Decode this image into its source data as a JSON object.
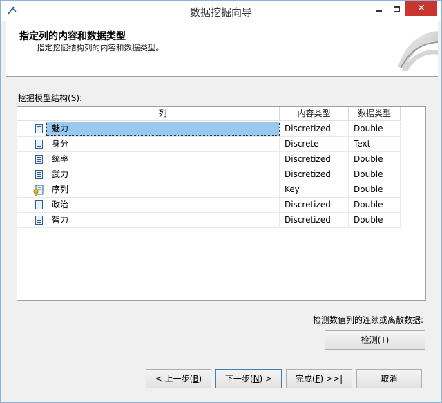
{
  "window": {
    "title": "数据挖掘向导",
    "close_glyph": "✕"
  },
  "header": {
    "title": "指定列的内容和数据类型",
    "subtitle": "指定挖掘结构列的内容和数据类型。"
  },
  "structure": {
    "label_pre": "挖掘模型结构(",
    "label_key": "S",
    "label_post": "):",
    "columns": {
      "name": "列",
      "content_type": "内容类型",
      "data_type": "数据类型"
    },
    "rows": [
      {
        "name": "魅力",
        "content_type": "Discretized",
        "data_type": "Double",
        "icon": "column-icon"
      },
      {
        "name": "身分",
        "content_type": "Discrete",
        "data_type": "Text",
        "icon": "column-icon"
      },
      {
        "name": "统率",
        "content_type": "Discretized",
        "data_type": "Double",
        "icon": "column-icon"
      },
      {
        "name": "武力",
        "content_type": "Discretized",
        "data_type": "Double",
        "icon": "column-icon"
      },
      {
        "name": "序列",
        "content_type": "Key",
        "data_type": "Double",
        "icon": "key-column-icon"
      },
      {
        "name": "政治",
        "content_type": "Discretized",
        "data_type": "Double",
        "icon": "column-icon"
      },
      {
        "name": "智力",
        "content_type": "Discretized",
        "data_type": "Double",
        "icon": "column-icon"
      }
    ]
  },
  "detect": {
    "label": "检测数值列的连续或离散数据:",
    "button_pre": "检测(",
    "button_key": "T",
    "button_post": ")"
  },
  "footer": {
    "back_pre": "< 上一步(",
    "back_key": "B",
    "back_post": ")",
    "next_pre": "下一步(",
    "next_key": "N",
    "next_post": ") >",
    "finish_pre": "完成(",
    "finish_key": "F",
    "finish_post": ") >>|",
    "cancel": "取消"
  }
}
